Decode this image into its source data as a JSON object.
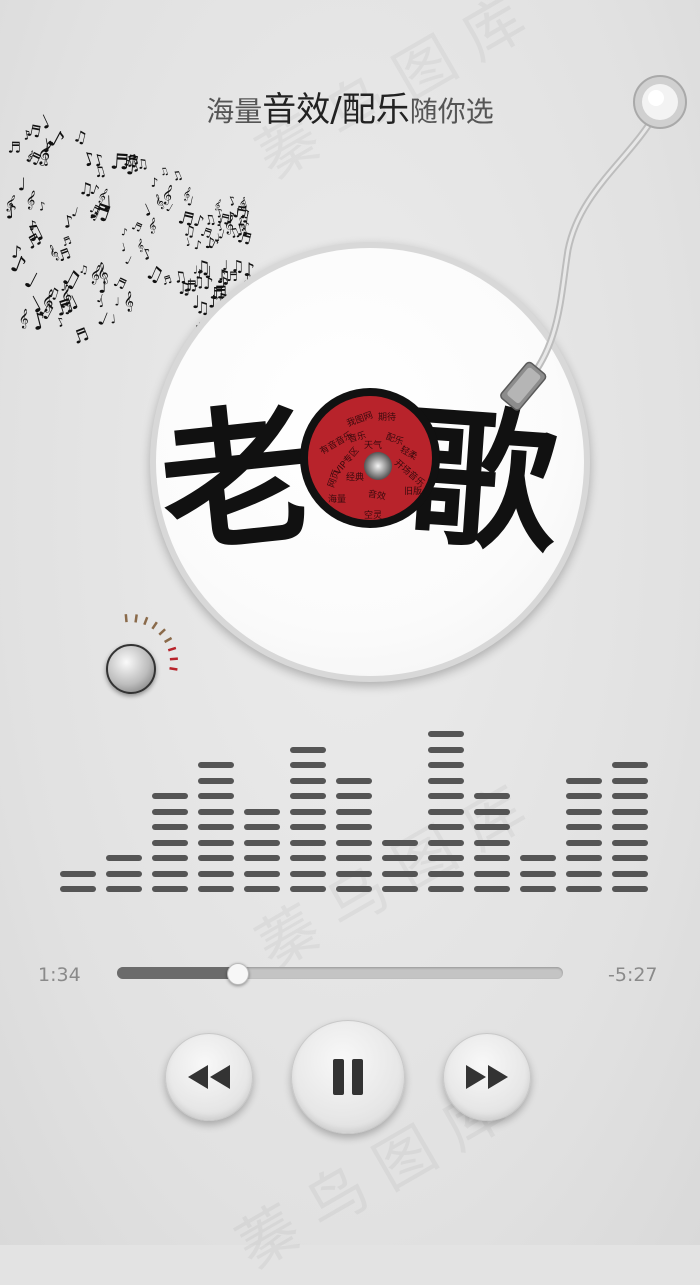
{
  "headline": {
    "part1": "海量",
    "part2": "音效/配乐",
    "part3": "随你选"
  },
  "record": {
    "title": "老歌",
    "label_words": [
      "我图网",
      "期待",
      "有音音乐",
      "VIP专区",
      "配乐",
      "轻柔",
      "音乐",
      "天气",
      "网页",
      "开场音乐",
      "音效",
      "海量",
      "空灵",
      "旧版",
      "经典"
    ]
  },
  "player": {
    "elapsed": "1:34",
    "remaining": "-5:27",
    "progress": 0.27
  },
  "equalizer": {
    "levels": [
      2,
      3,
      7,
      9,
      6,
      10,
      8,
      4,
      11,
      7,
      3,
      8,
      9
    ]
  },
  "colors": {
    "accent_red": "#b8232b",
    "bar_gray": "#555555"
  },
  "controls": {
    "rewind_icon": "rewind-icon",
    "pause_icon": "pause-icon",
    "forward_icon": "fast-forward-icon"
  },
  "watermark": "蓁 鸟 图 库"
}
